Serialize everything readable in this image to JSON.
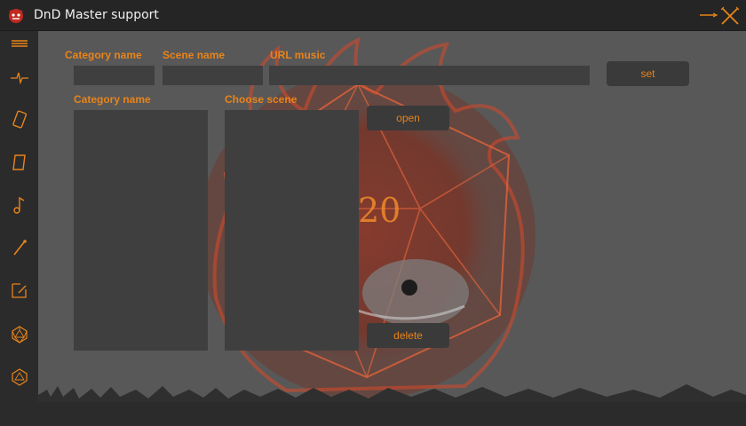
{
  "window": {
    "title": "DnD Master support"
  },
  "sidebar": {
    "items": [
      {
        "icon": "hamburger-menu-icon"
      },
      {
        "icon": "pulse-icon"
      },
      {
        "icon": "dice-icon"
      },
      {
        "icon": "scroll-icon"
      },
      {
        "icon": "music-note-icon"
      },
      {
        "icon": "wand-icon"
      },
      {
        "icon": "edit-square-icon"
      },
      {
        "icon": "d20-icon"
      },
      {
        "icon": "d20-outline-icon"
      }
    ]
  },
  "form": {
    "category_name_label": "Category name",
    "scene_name_label": "Scene name",
    "url_music_label": "URL music",
    "category_name_value": "",
    "scene_name_value": "",
    "url_music_value": "",
    "set_button": "set"
  },
  "lists": {
    "category_label": "Category name",
    "scene_label": "Choose scene",
    "categories": [],
    "scenes": []
  },
  "actions": {
    "open_button": "open",
    "delete_button": "delete"
  },
  "background": {
    "die_face_number": "20"
  },
  "colors": {
    "accent": "#e8841a",
    "panel": "#585858",
    "field": "#3f3f3f",
    "titlebar": "#252525",
    "sidebar": "#2b2b2b"
  }
}
